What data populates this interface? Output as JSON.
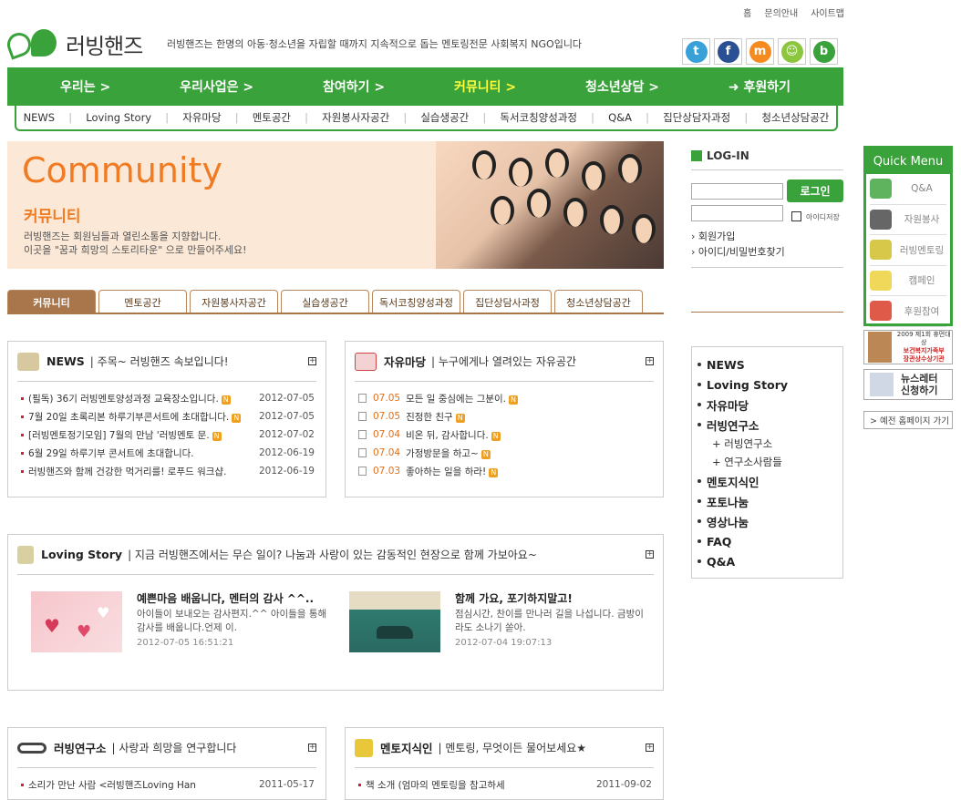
{
  "top_links": [
    "홈",
    "문의안내",
    "사이트맵"
  ],
  "logo": {
    "text": "러빙핸즈"
  },
  "tagline": "러빙핸즈는 한명의 아동·청소년을 자립할 때까지 지속적으로 돕는 멘토링전문 사회복지 NGO입니다",
  "social": [
    {
      "icon": "twitter-icon",
      "glyph": "t",
      "color": "#3aa1d8"
    },
    {
      "icon": "facebook-icon",
      "glyph": "f",
      "color": "#2a4f93"
    },
    {
      "icon": "me2day-icon",
      "glyph": "m",
      "color": "#f58a1f"
    },
    {
      "icon": "character-icon",
      "glyph": "☺",
      "color": "#8cc63f"
    },
    {
      "icon": "blog-icon",
      "glyph": "b",
      "color": "#3aa23a"
    }
  ],
  "main_nav": [
    {
      "label": "우리는 >"
    },
    {
      "label": "우리사업은 >"
    },
    {
      "label": "참여하기 >"
    },
    {
      "label": "커뮤니티 >",
      "active": true
    },
    {
      "label": "청소년상담 >"
    },
    {
      "label": "➜ 후원하기"
    }
  ],
  "sub_nav": [
    "NEWS",
    "Loving Story",
    "자유마당",
    "멘토공간",
    "자원봉사자공간",
    "실습생공간",
    "독서코칭양성과정",
    "Q&A",
    "집단상담자과정",
    "청소년상담공간"
  ],
  "banner": {
    "title": "Community",
    "subtitle": "커뮤니티",
    "desc1": "러빙핸즈는 회원님들과 열린소통을 지향합니다.",
    "desc2": "이곳을 \"꿈과 희망의 스토리타운\" 으로 만들어주세요!"
  },
  "tabs": [
    {
      "label": "커뮤니티",
      "active": true
    },
    {
      "label": "멘토공간"
    },
    {
      "label": "자원봉사자공간"
    },
    {
      "label": "실습생공간"
    },
    {
      "label": "독서코칭양성과정"
    },
    {
      "label": "집단상담사과정"
    },
    {
      "label": "청소년상담공간"
    }
  ],
  "news": {
    "title": "NEWS",
    "subtitle": "주목~ 러빙핸즈 속보입니다!",
    "items": [
      {
        "title": "(필독) 36기 러빙멘토양성과정 교육장소입니다.",
        "date": "2012-07-05",
        "new": true
      },
      {
        "title": "7월 20일 초록리본 하루기부콘서트에 초대합니다.",
        "date": "2012-07-05",
        "new": true
      },
      {
        "title": "[러빙멘토정기모임] 7월의 만남 '러빙멘토 문.",
        "date": "2012-07-02",
        "new": true
      },
      {
        "title": "6월 29일 하루기부 콘서트에 초대합니다.",
        "date": "2012-06-19",
        "new": false
      },
      {
        "title": "러빙핸즈와 함께 건강한 먹거리를! 로푸드 워크샵.",
        "date": "2012-06-19",
        "new": false
      }
    ]
  },
  "free": {
    "title": "자유마당",
    "subtitle": "누구에게나 열려있는 자유공간",
    "items": [
      {
        "date": "07.05",
        "title": "모든 일 중심에는 그분이.",
        "new": true
      },
      {
        "date": "07.05",
        "title": "진정한 친구",
        "new": true
      },
      {
        "date": "07.04",
        "title": "비온 뒤, 감사합니다.",
        "new": true
      },
      {
        "date": "07.04",
        "title": "가정방문을 하고~",
        "new": true
      },
      {
        "date": "07.03",
        "title": "좋아하는 일을 하라!",
        "new": true
      }
    ]
  },
  "story": {
    "title": "Loving Story",
    "subtitle": "지금 러빙핸즈에서는 무슨 일이? 나눔과 사랑이 있는 감동적인 현장으로 함께 가보아요~",
    "items": [
      {
        "title": "예쁜마음 배웁니다, 멘터의 감사 ^^..",
        "desc": "아이들이 보내오는 감사편지.^^ 아이들을 통해 감사를 배웁니다.언제 이.",
        "date": "2012-07-05 16:51:21"
      },
      {
        "title": "함께 가요, 포기하지말고!",
        "desc": "점심시간, 찬이를 만나러 길을 나섭니다. 금방이라도 소나기 쏟아.",
        "date": "2012-07-04 19:07:13"
      }
    ]
  },
  "research": {
    "title": "러빙연구소",
    "subtitle": "사랑과 희망을 연구합니다",
    "items": [
      {
        "title": "소리가 만난 사람 <러빙핸즈Loving Han",
        "date": "2011-05-17"
      }
    ]
  },
  "mentor": {
    "title": "멘토지식인",
    "subtitle": "멘토링, 무엇이든 물어보세요★",
    "items": [
      {
        "title": "책 소개 (엄마의 멘토링을 참고하세",
        "date": "2011-09-02"
      }
    ]
  },
  "login": {
    "title": "LOG-IN",
    "button": "로그인",
    "save_id": "아이디저장",
    "join": "회원가입",
    "find": "아이디/비밀번호찾기"
  },
  "side_menu": [
    {
      "label": "NEWS"
    },
    {
      "label": "Loving Story"
    },
    {
      "label": "자유마당"
    },
    {
      "label": "러빙연구소",
      "children": [
        "+ 러빙연구소",
        "+ 연구소사람들"
      ]
    },
    {
      "label": "멘토지식인"
    },
    {
      "label": "포토나눔"
    },
    {
      "label": "영상나눔"
    },
    {
      "label": "FAQ"
    },
    {
      "label": "Q&A"
    }
  ],
  "quick_menu": {
    "title": "Quick Menu",
    "items": [
      {
        "label": "Q&A",
        "icon": "search-icon",
        "color": "#5fb35f"
      },
      {
        "label": "자원봉사",
        "icon": "person-plus-icon",
        "color": "#666"
      },
      {
        "label": "러빙멘토링",
        "icon": "leaf-icon",
        "color": "#d8c84a"
      },
      {
        "label": "캠페인",
        "icon": "lightbulb-icon",
        "color": "#f0d85a"
      },
      {
        "label": "후원참여",
        "icon": "heart-icon",
        "color": "#e05a4a"
      }
    ]
  },
  "award": {
    "line1": "2009 제1회 휴먼대상",
    "line2": "보건복지가족부",
    "line3": "장관상수상기관"
  },
  "newsletter": {
    "line1": "뉴스레터",
    "line2": "신청하기"
  },
  "old_site": "> 예전 홈페이지 가기"
}
